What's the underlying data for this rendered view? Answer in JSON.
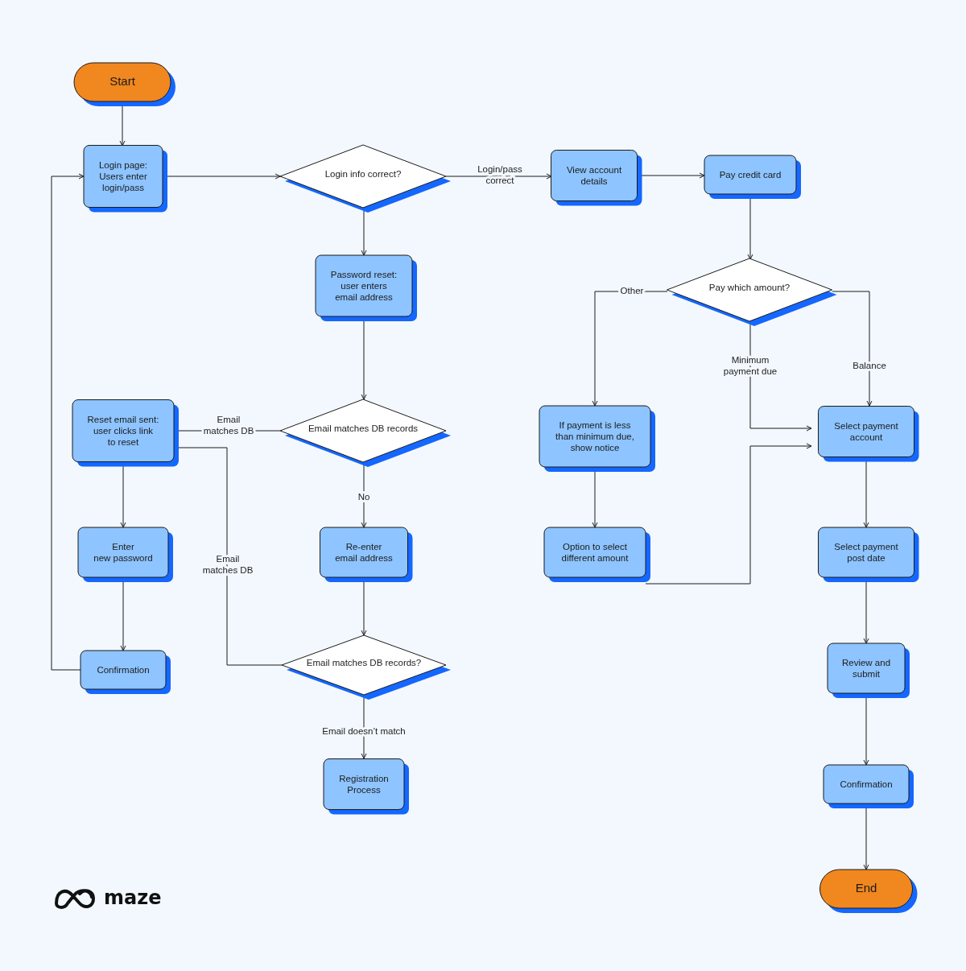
{
  "flowchart": {
    "nodes": [
      {
        "kind": "terminal",
        "lines": [
          "Start"
        ]
      },
      {
        "kind": "process",
        "lines": [
          "Login page:",
          "Users enter",
          "login/pass"
        ]
      },
      {
        "kind": "decision",
        "lines": [
          "Login info correct?"
        ]
      },
      {
        "kind": "process",
        "lines": [
          "View account",
          "details"
        ]
      },
      {
        "kind": "process",
        "lines": [
          "Pay credit card"
        ]
      },
      {
        "kind": "process",
        "lines": [
          "Password reset:",
          "user enters",
          "email address"
        ]
      },
      {
        "kind": "decision",
        "lines": [
          "Pay which amount?"
        ]
      },
      {
        "kind": "process",
        "lines": [
          "Reset email sent:",
          "user clicks link",
          "to reset"
        ]
      },
      {
        "kind": "decision",
        "lines": [
          "Email matches DB records"
        ]
      },
      {
        "kind": "process",
        "lines": [
          "If payment is less",
          "than minimum due,",
          "show notice"
        ]
      },
      {
        "kind": "process",
        "lines": [
          "Select payment",
          "account"
        ]
      },
      {
        "kind": "process",
        "lines": [
          "Enter",
          "new password"
        ]
      },
      {
        "kind": "process",
        "lines": [
          "Re-enter",
          "email address"
        ]
      },
      {
        "kind": "process",
        "lines": [
          "Option to select",
          "different amount"
        ]
      },
      {
        "kind": "process",
        "lines": [
          "Select payment",
          "post date"
        ]
      },
      {
        "kind": "process",
        "lines": [
          "Confirmation"
        ]
      },
      {
        "kind": "decision",
        "lines": [
          "Email matches DB records?"
        ]
      },
      {
        "kind": "process",
        "lines": [
          "Review and",
          "submit"
        ]
      },
      {
        "kind": "process",
        "lines": [
          "Registration",
          "Process"
        ]
      },
      {
        "kind": "process",
        "lines": [
          "Confirmation"
        ]
      },
      {
        "kind": "terminal",
        "lines": [
          "End"
        ]
      }
    ],
    "connector_labels": [
      {
        "lines": [
          "Login/pass",
          "correct"
        ]
      },
      {
        "lines": [
          "Email",
          "matches DB"
        ]
      },
      {
        "lines": [
          "No"
        ]
      },
      {
        "lines": [
          "Email",
          "matches DB"
        ]
      },
      {
        "lines": [
          "Email doesn’t match"
        ]
      },
      {
        "lines": [
          "Other"
        ]
      },
      {
        "lines": [
          "Balance"
        ]
      },
      {
        "lines": [
          "Minimum",
          "payment due"
        ]
      }
    ]
  },
  "logo": {
    "wordmark": "maze"
  }
}
